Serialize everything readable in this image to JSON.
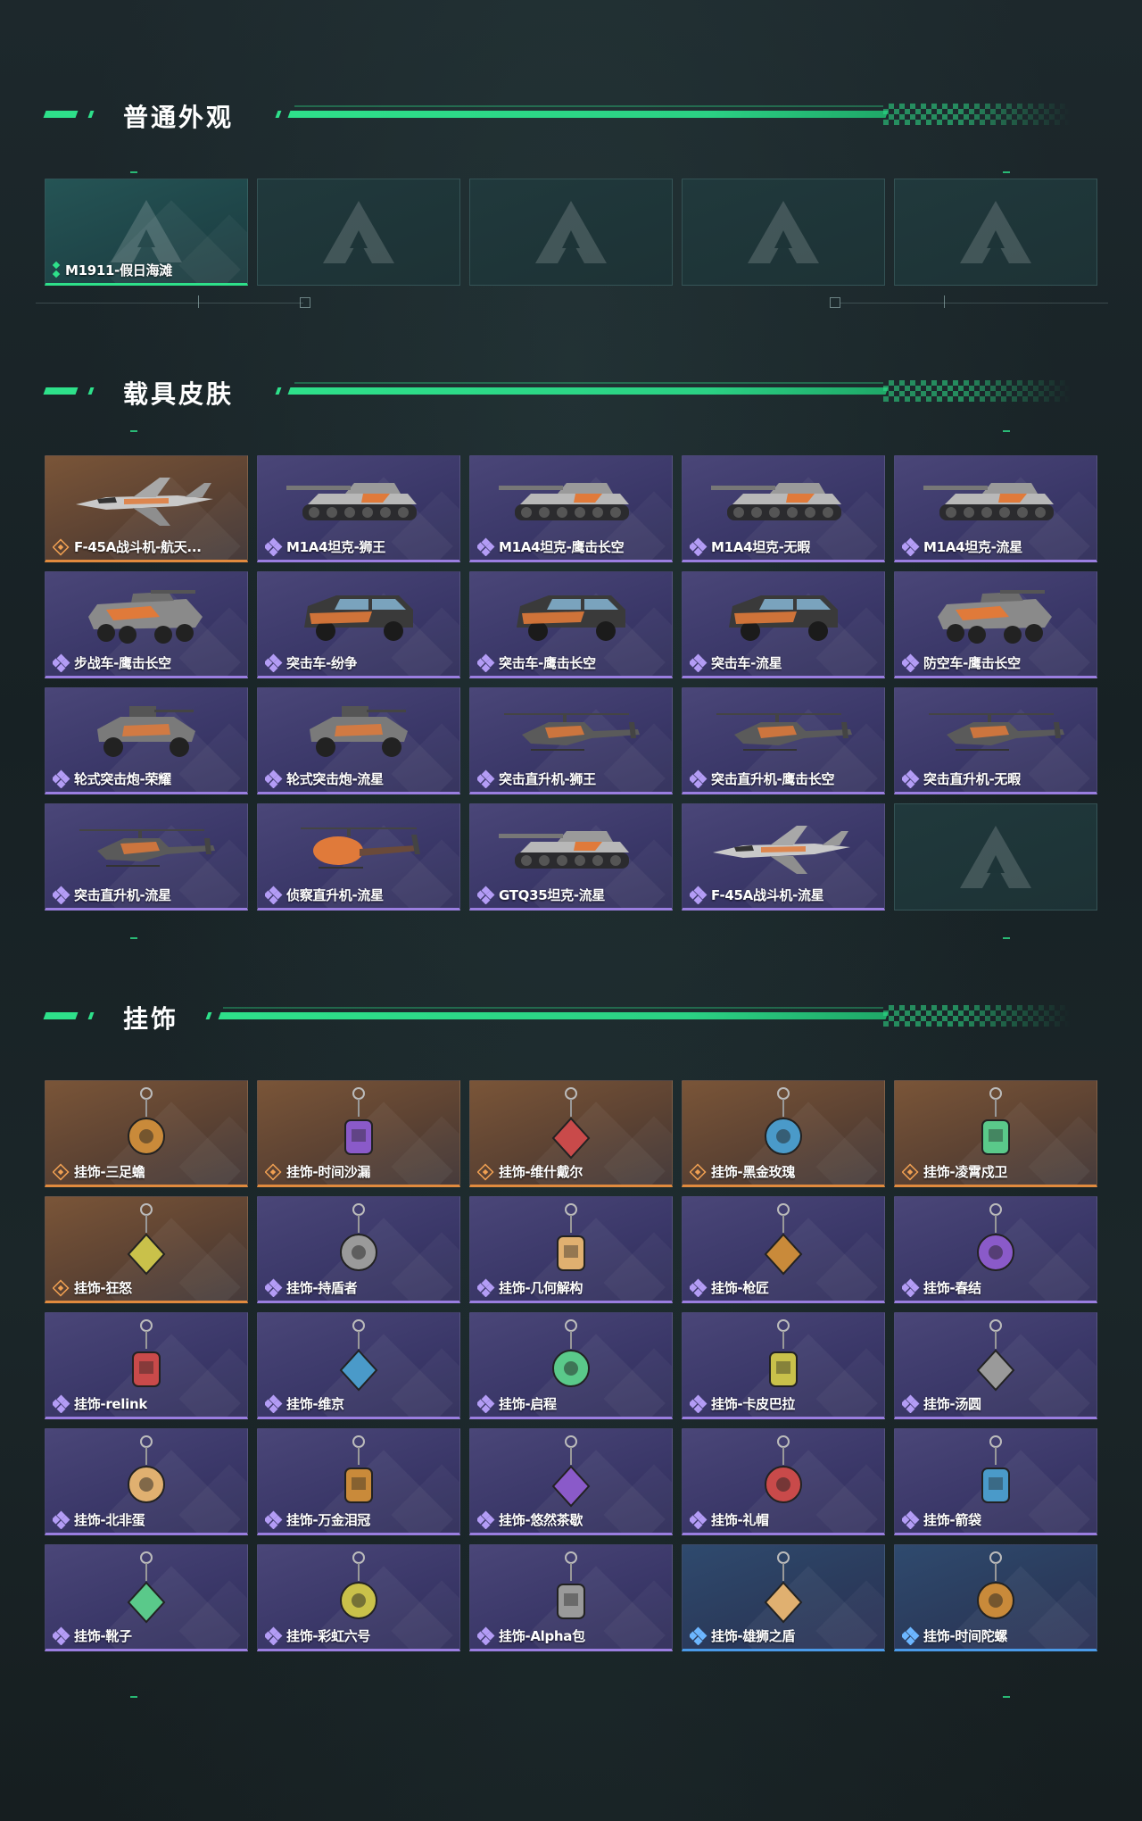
{
  "colors": {
    "accent": "#2ee08a",
    "rarity_purple": "#9a7ee0",
    "rarity_orange": "#e08a3e",
    "rarity_blue": "#4a9ae8",
    "background": "#1a2428"
  },
  "sections": {
    "appearance": {
      "title": "普通外观",
      "items": [
        {
          "label": "M1911-假日海滩",
          "rarity": "teal"
        },
        {
          "label": "",
          "rarity": "empty"
        },
        {
          "label": "",
          "rarity": "empty"
        },
        {
          "label": "",
          "rarity": "empty"
        },
        {
          "label": "",
          "rarity": "empty"
        }
      ]
    },
    "vehicles": {
      "title": "载具皮肤",
      "items": [
        {
          "label": "F-45A战斗机-航天...",
          "rarity": "orange",
          "icon": "jet-icon"
        },
        {
          "label": "M1A4坦克-狮王",
          "rarity": "purple",
          "icon": "tank-icon"
        },
        {
          "label": "M1A4坦克-鹰击长空",
          "rarity": "purple",
          "icon": "tank-icon"
        },
        {
          "label": "M1A4坦克-无暇",
          "rarity": "purple",
          "icon": "tank-icon"
        },
        {
          "label": "M1A4坦克-流星",
          "rarity": "purple",
          "icon": "tank-icon"
        },
        {
          "label": "步战车-鹰击长空",
          "rarity": "purple",
          "icon": "apc-icon"
        },
        {
          "label": "突击车-纷争",
          "rarity": "purple",
          "icon": "truck-icon"
        },
        {
          "label": "突击车-鹰击长空",
          "rarity": "purple",
          "icon": "truck-icon"
        },
        {
          "label": "突击车-流星",
          "rarity": "purple",
          "icon": "truck-icon"
        },
        {
          "label": "防空车-鹰击长空",
          "rarity": "purple",
          "icon": "apc-icon"
        },
        {
          "label": "轮式突击炮-荣耀",
          "rarity": "purple",
          "icon": "buggy-icon"
        },
        {
          "label": "轮式突击炮-流星",
          "rarity": "purple",
          "icon": "buggy-icon"
        },
        {
          "label": "突击直升机-狮王",
          "rarity": "purple",
          "icon": "helicopter-icon"
        },
        {
          "label": "突击直升机-鹰击长空",
          "rarity": "purple",
          "icon": "helicopter-icon"
        },
        {
          "label": "突击直升机-无暇",
          "rarity": "purple",
          "icon": "helicopter-icon"
        },
        {
          "label": "突击直升机-流星",
          "rarity": "purple",
          "icon": "helicopter-icon"
        },
        {
          "label": "侦察直升机-流星",
          "rarity": "purple",
          "icon": "scout-helicopter-icon"
        },
        {
          "label": "GTQ35坦克-流星",
          "rarity": "purple",
          "icon": "tank-icon"
        },
        {
          "label": "F-45A战斗机-流星",
          "rarity": "purple",
          "icon": "jet-icon"
        },
        {
          "label": "",
          "rarity": "empty"
        }
      ]
    },
    "charms": {
      "title": "挂饰",
      "items": [
        {
          "label": "挂饰-三足蟾",
          "rarity": "orange"
        },
        {
          "label": "挂饰-时间沙漏",
          "rarity": "orange"
        },
        {
          "label": "挂饰-维什戴尔",
          "rarity": "orange"
        },
        {
          "label": "挂饰-黑金玫瑰",
          "rarity": "orange"
        },
        {
          "label": "挂饰-凌霄戍卫",
          "rarity": "orange"
        },
        {
          "label": "挂饰-狂怒",
          "rarity": "orange"
        },
        {
          "label": "挂饰-持盾者",
          "rarity": "purple"
        },
        {
          "label": "挂饰-几何解构",
          "rarity": "purple"
        },
        {
          "label": "挂饰-枪匠",
          "rarity": "purple"
        },
        {
          "label": "挂饰-春结",
          "rarity": "purple"
        },
        {
          "label": "挂饰-relink",
          "rarity": "purple"
        },
        {
          "label": "挂饰-维京",
          "rarity": "purple"
        },
        {
          "label": "挂饰-启程",
          "rarity": "purple"
        },
        {
          "label": "挂饰-卡皮巴拉",
          "rarity": "purple"
        },
        {
          "label": "挂饰-汤圆",
          "rarity": "purple"
        },
        {
          "label": "挂饰-北非蛋",
          "rarity": "purple"
        },
        {
          "label": "挂饰-万金泪冠",
          "rarity": "purple"
        },
        {
          "label": "挂饰-悠然茶歇",
          "rarity": "purple"
        },
        {
          "label": "挂饰-礼帽",
          "rarity": "purple"
        },
        {
          "label": "挂饰-箭袋",
          "rarity": "purple"
        },
        {
          "label": "挂饰-靴子",
          "rarity": "purple"
        },
        {
          "label": "挂饰-彩虹六号",
          "rarity": "purple"
        },
        {
          "label": "挂饰-Alpha包",
          "rarity": "purple"
        },
        {
          "label": "挂饰-雄狮之盾",
          "rarity": "blue"
        },
        {
          "label": "挂饰-时间陀螺",
          "rarity": "blue"
        }
      ]
    }
  }
}
